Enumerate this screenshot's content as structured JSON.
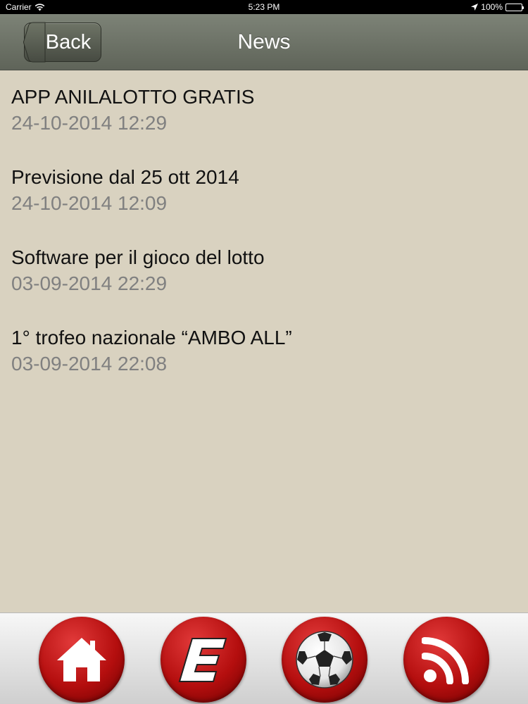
{
  "status_bar": {
    "carrier": "Carrier",
    "time": "5:23 PM",
    "battery": "100%"
  },
  "nav": {
    "back_label": "Back",
    "title": "News"
  },
  "news": [
    {
      "title": "APP ANILALOTTO GRATIS",
      "date": "24-10-2014 12:29"
    },
    {
      "title": "Previsione dal 25 ott 2014",
      "date": "24-10-2014 12:09"
    },
    {
      "title": "Software per il gioco del lotto",
      "date": "03-09-2014 22:29"
    },
    {
      "title": "1° trofeo nazionale “AMBO ALL”",
      "date": "03-09-2014 22:08"
    }
  ],
  "tabs": [
    {
      "icon": "home-icon"
    },
    {
      "icon": "e-logo-icon"
    },
    {
      "icon": "soccer-ball-icon"
    },
    {
      "icon": "rss-icon"
    }
  ],
  "colors": {
    "background": "#d9d2c0",
    "nav_bar": "#6b7064",
    "tab_button": "#c01010",
    "date_text": "#808080"
  }
}
